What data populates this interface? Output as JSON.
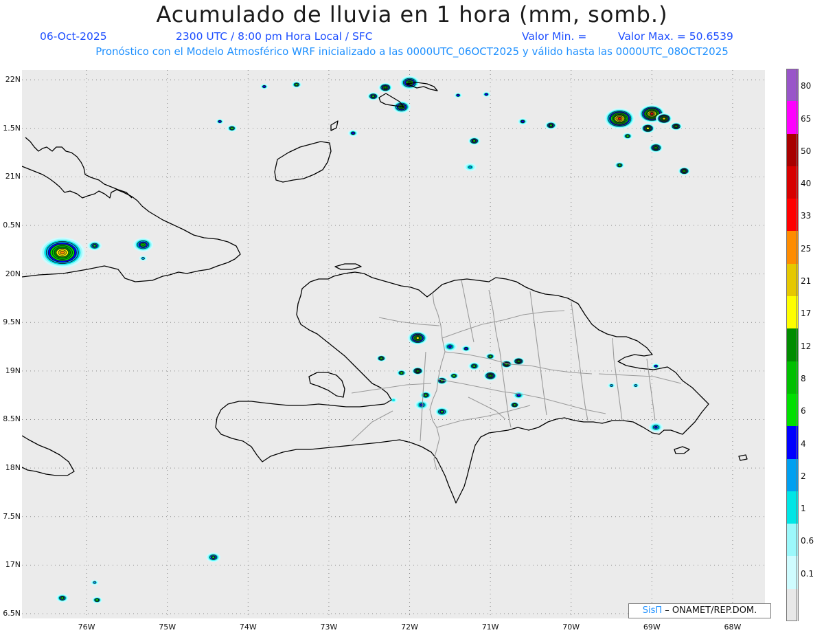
{
  "header": {
    "title": "Acumulado de lluvia en 1 hora (mm, somb.)",
    "date": "06-Oct-2025",
    "valid_time": "2300 UTC / 8:00 pm Hora Local / SFC",
    "min_label": "Valor Min. =",
    "max_label": "Valor Max. = 50.6539",
    "model_line": "Pronóstico con el Modelo Atmosférico WRF inicializado a las 0000UTC_06OCT2025 y válido hasta las  0000UTC_08OCT2025"
  },
  "axes": {
    "lat_labels": [
      "22N",
      "1.5N",
      "21N",
      "0.5N",
      "20N",
      "9.5N",
      "19N",
      "8.5N",
      "18N",
      "7.5N",
      "17N",
      "6.5N"
    ],
    "lat_values": [
      22,
      21.5,
      21,
      20.5,
      20,
      19.5,
      19,
      18.5,
      18,
      17.5,
      17,
      16.5
    ],
    "lon_labels": [
      "76W",
      "75W",
      "74W",
      "73W",
      "72W",
      "71W",
      "70W",
      "69W",
      "68W"
    ],
    "lon_values": [
      -76,
      -75,
      -74,
      -73,
      -72,
      -71,
      -70,
      -69,
      -68
    ],
    "lon_range": [
      -76.8,
      -67.6
    ],
    "lat_range": [
      16.45,
      22.1
    ]
  },
  "colorbar": {
    "labels": [
      "80",
      "65",
      "50",
      "40",
      "33",
      "25",
      "21",
      "17",
      "12",
      "8",
      "6",
      "4",
      "2",
      "1",
      "0.6",
      "0.1"
    ],
    "thresholds": [
      0.1,
      0.6,
      1,
      2,
      4,
      6,
      8,
      12,
      17,
      21,
      25,
      33,
      40,
      50,
      65,
      80
    ],
    "colors": [
      "#e8e8e8",
      "#cffcff",
      "#9cf8fb",
      "#00e6e6",
      "#00a0f0",
      "#0000ff",
      "#00e000",
      "#00c000",
      "#008c00",
      "#fefe00",
      "#e6c800",
      "#ff8c00",
      "#ff0000",
      "#d70000",
      "#a80000",
      "#ff00ff",
      "#9955c9"
    ]
  },
  "credit": {
    "brand": "SisΠ",
    "org": " – ONAMET/REP.DOM."
  },
  "rain_cells": [
    {
      "lon": -76.3,
      "lat": 20.22,
      "r": 0.22,
      "max": 25
    },
    {
      "lon": -75.9,
      "lat": 20.29,
      "r": 0.07,
      "max": 6
    },
    {
      "lon": -75.3,
      "lat": 20.3,
      "r": 0.1,
      "max": 8
    },
    {
      "lon": -75.3,
      "lat": 20.16,
      "r": 0.04,
      "max": 2
    },
    {
      "lon": -73.4,
      "lat": 21.95,
      "r": 0.05,
      "max": 6
    },
    {
      "lon": -73.8,
      "lat": 21.93,
      "r": 0.04,
      "max": 4
    },
    {
      "lon": -72.3,
      "lat": 21.92,
      "r": 0.07,
      "max": 12
    },
    {
      "lon": -72.1,
      "lat": 21.72,
      "r": 0.09,
      "max": 12
    },
    {
      "lon": -72.45,
      "lat": 21.83,
      "r": 0.06,
      "max": 8
    },
    {
      "lon": -72.0,
      "lat": 21.97,
      "r": 0.1,
      "max": 12
    },
    {
      "lon": -72.7,
      "lat": 21.45,
      "r": 0.05,
      "max": 4
    },
    {
      "lon": -74.2,
      "lat": 21.5,
      "r": 0.05,
      "max": 6
    },
    {
      "lon": -74.35,
      "lat": 21.57,
      "r": 0.04,
      "max": 4
    },
    {
      "lon": -71.2,
      "lat": 21.37,
      "r": 0.06,
      "max": 8
    },
    {
      "lon": -71.05,
      "lat": 21.85,
      "r": 0.04,
      "max": 4
    },
    {
      "lon": -71.4,
      "lat": 21.84,
      "r": 0.04,
      "max": 4
    },
    {
      "lon": -70.6,
      "lat": 21.57,
      "r": 0.05,
      "max": 4
    },
    {
      "lon": -70.25,
      "lat": 21.53,
      "r": 0.06,
      "max": 8
    },
    {
      "lon": -71.25,
      "lat": 21.1,
      "r": 0.06,
      "max": 2
    },
    {
      "lon": -69.4,
      "lat": 21.6,
      "r": 0.15,
      "max": 33
    },
    {
      "lon": -69.0,
      "lat": 21.65,
      "r": 0.13,
      "max": 33
    },
    {
      "lon": -68.85,
      "lat": 21.6,
      "r": 0.08,
      "max": 21
    },
    {
      "lon": -68.7,
      "lat": 21.52,
      "r": 0.06,
      "max": 12
    },
    {
      "lon": -69.05,
      "lat": 21.5,
      "r": 0.07,
      "max": 17
    },
    {
      "lon": -68.95,
      "lat": 21.3,
      "r": 0.07,
      "max": 12
    },
    {
      "lon": -69.3,
      "lat": 21.42,
      "r": 0.05,
      "max": 6
    },
    {
      "lon": -68.6,
      "lat": 21.06,
      "r": 0.06,
      "max": 12
    },
    {
      "lon": -69.4,
      "lat": 21.12,
      "r": 0.05,
      "max": 6
    },
    {
      "lon": -74.43,
      "lat": 17.08,
      "r": 0.07,
      "max": 6
    },
    {
      "lon": -76.3,
      "lat": 16.66,
      "r": 0.06,
      "max": 6
    },
    {
      "lon": -75.87,
      "lat": 16.64,
      "r": 0.05,
      "max": 6
    },
    {
      "lon": -75.9,
      "lat": 16.82,
      "r": 0.04,
      "max": 2
    },
    {
      "lon": -71.9,
      "lat": 19.34,
      "r": 0.1,
      "max": 17
    },
    {
      "lon": -72.35,
      "lat": 19.13,
      "r": 0.05,
      "max": 8
    },
    {
      "lon": -72.1,
      "lat": 18.98,
      "r": 0.05,
      "max": 6
    },
    {
      "lon": -71.9,
      "lat": 19.0,
      "r": 0.06,
      "max": 12
    },
    {
      "lon": -71.6,
      "lat": 18.9,
      "r": 0.06,
      "max": 8
    },
    {
      "lon": -71.45,
      "lat": 18.95,
      "r": 0.05,
      "max": 6
    },
    {
      "lon": -71.2,
      "lat": 19.05,
      "r": 0.06,
      "max": 6
    },
    {
      "lon": -71.0,
      "lat": 18.95,
      "r": 0.07,
      "max": 12
    },
    {
      "lon": -71.0,
      "lat": 19.15,
      "r": 0.05,
      "max": 6
    },
    {
      "lon": -70.8,
      "lat": 19.07,
      "r": 0.06,
      "max": 12
    },
    {
      "lon": -70.65,
      "lat": 19.1,
      "r": 0.06,
      "max": 12
    },
    {
      "lon": -70.65,
      "lat": 18.75,
      "r": 0.06,
      "max": 4
    },
    {
      "lon": -70.7,
      "lat": 18.65,
      "r": 0.05,
      "max": 8
    },
    {
      "lon": -71.5,
      "lat": 19.25,
      "r": 0.07,
      "max": 4
    },
    {
      "lon": -71.8,
      "lat": 18.75,
      "r": 0.06,
      "max": 6
    },
    {
      "lon": -71.6,
      "lat": 18.58,
      "r": 0.07,
      "max": 6
    },
    {
      "lon": -71.85,
      "lat": 18.65,
      "r": 0.07,
      "max": 4
    },
    {
      "lon": -71.3,
      "lat": 19.23,
      "r": 0.05,
      "max": 4
    },
    {
      "lon": -69.5,
      "lat": 18.85,
      "r": 0.04,
      "max": 2
    },
    {
      "lon": -69.2,
      "lat": 18.85,
      "r": 0.04,
      "max": 2
    },
    {
      "lon": -68.95,
      "lat": 19.05,
      "r": 0.04,
      "max": 4
    },
    {
      "lon": -68.95,
      "lat": 18.42,
      "r": 0.07,
      "max": 4
    },
    {
      "lon": -72.2,
      "lat": 18.7,
      "r": 0.04,
      "max": 1
    }
  ]
}
